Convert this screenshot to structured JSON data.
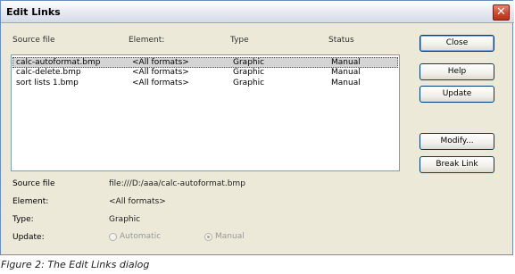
{
  "window": {
    "title": "Edit Links",
    "close_glyph": "✕"
  },
  "columns": {
    "source": "Source file",
    "element": "Element:",
    "type": "Type",
    "status": "Status"
  },
  "rows": [
    {
      "source": "calc-autoformat.bmp",
      "element": "<All formats>",
      "type": "Graphic",
      "status": "Manual"
    },
    {
      "source": "calc-delete.bmp",
      "element": "<All formats>",
      "type": "Graphic",
      "status": "Manual"
    },
    {
      "source": "sort lists 1.bmp",
      "element": "<All formats>",
      "type": "Graphic",
      "status": "Manual"
    }
  ],
  "buttons": {
    "close": "Close",
    "help": "Help",
    "update": "Update",
    "modify": "Modify...",
    "break_link": "Break Link"
  },
  "details": {
    "source_label": "Source file",
    "source_value": "file:///D:/aaa/calc-autoformat.bmp",
    "element_label": "Element:",
    "element_value": "<All formats>",
    "type_label": "Type:",
    "type_value": "Graphic",
    "update_label": "Update:",
    "update_automatic": "Automatic",
    "update_manual": "Manual"
  },
  "caption": "Figure 2: The Edit Links dialog"
}
